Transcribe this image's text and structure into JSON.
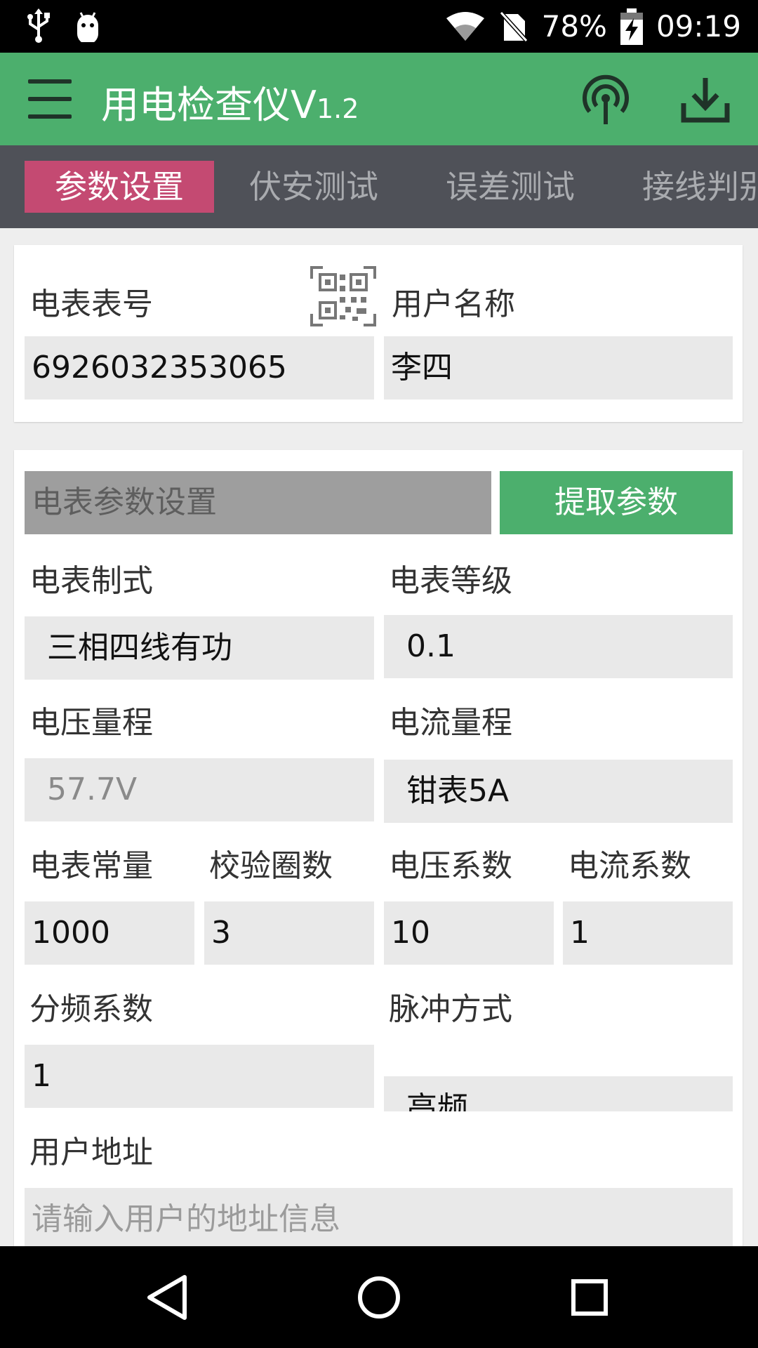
{
  "status_bar": {
    "icons": [
      "usb-icon",
      "android-debug-icon",
      "wifi-icon",
      "no-sim-icon",
      "battery-charging-icon"
    ],
    "battery": "78%",
    "time": "09:19"
  },
  "app_bar": {
    "title": "用电检查仪V",
    "version": "1.2",
    "icons": [
      "menu-icon",
      "signal-antenna-icon",
      "download-icon"
    ]
  },
  "tabs": [
    "参数设置",
    "伏安测试",
    "误差测试",
    "接线判别"
  ],
  "active_tab": 0,
  "meter_info": {
    "meter_no_label": "电表表号",
    "meter_no_value": "6926032353065",
    "user_name_label": "用户名称",
    "user_name_value": "李四",
    "qr_icon": "qr-code-icon"
  },
  "params": {
    "section_title": "电表参数设置",
    "extract_button": "提取参数",
    "meter_system_label": "电表制式",
    "meter_system_value": "三相四线有功",
    "meter_class_label": "电表等级",
    "meter_class_value": "0.1",
    "voltage_range_label": "电压量程",
    "voltage_range_value": "57.7V",
    "current_range_label": "电流量程",
    "current_range_value": "钳表5A",
    "meter_constant_label": "电表常量",
    "meter_constant_value": "1000",
    "check_turns_label": "校验圈数",
    "check_turns_value": "3",
    "voltage_coef_label": "电压系数",
    "voltage_coef_value": "10",
    "current_coef_label": "电流系数",
    "current_coef_value": "1",
    "freq_div_label": "分频系数",
    "freq_div_value": "1",
    "pulse_mode_label": "脉冲方式",
    "pulse_mode_value": "高频",
    "address_label": "用户地址",
    "address_placeholder": "请输入用户的地址信息"
  },
  "nav_bar": {
    "icons": [
      "back-icon",
      "home-icon",
      "recents-icon"
    ]
  },
  "colors": {
    "app_bar": "#4caf6d",
    "tab_bar": "#4f5158",
    "active_tab": "#c44a72",
    "button": "#4caf6d"
  }
}
